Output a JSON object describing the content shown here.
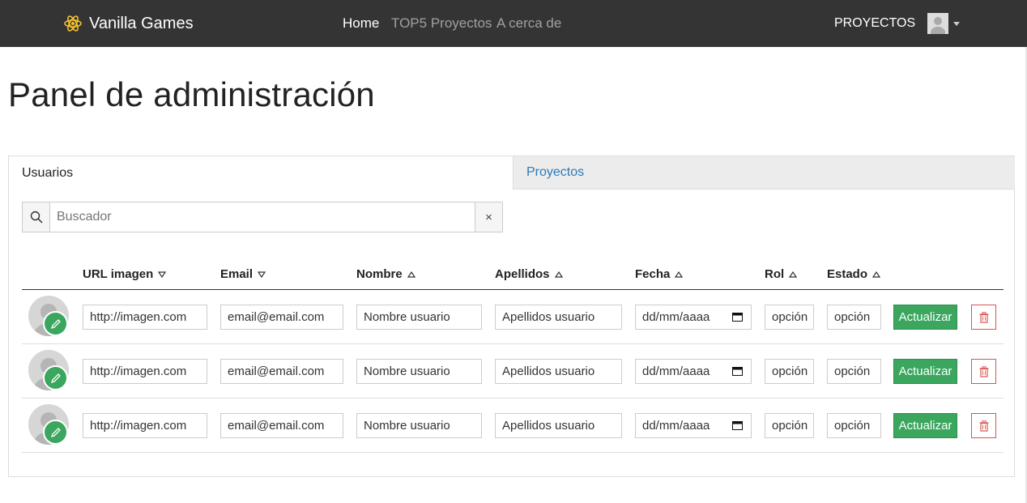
{
  "navbar": {
    "brand": "Vanilla Games",
    "links": [
      {
        "label": "Home",
        "active": true
      },
      {
        "label": "TOP5 Proyectos",
        "active": false
      },
      {
        "label": "A cerca de",
        "active": false
      }
    ],
    "user_menu_label": "PROYECTOS",
    "logo_icon": "atom-icon",
    "logo_color": "#f2c230"
  },
  "page_title": "Panel de administración",
  "tabs": [
    {
      "label": "Usuarios",
      "active": true
    },
    {
      "label": "Proyectos",
      "active": false
    }
  ],
  "search": {
    "placeholder": "Buscador",
    "clear_label": "×"
  },
  "table": {
    "columns": [
      {
        "label": "URL imagen",
        "sort": "desc"
      },
      {
        "label": "Email",
        "sort": "desc"
      },
      {
        "label": "Nombre",
        "sort": "asc"
      },
      {
        "label": "Apellidos",
        "sort": "asc"
      },
      {
        "label": "Fecha",
        "sort": "asc"
      },
      {
        "label": "Rol",
        "sort": "asc"
      },
      {
        "label": "Estado",
        "sort": "asc"
      }
    ],
    "rows": [
      {
        "url": "http://imagen.com",
        "email": "email@email.com",
        "nombre": "Nombre usuario",
        "apellidos": "Apellidos usuario",
        "fecha": "dd/mm/aaaa",
        "rol": "opción",
        "estado": "opción",
        "update_label": "Actualizar"
      },
      {
        "url": "http://imagen.com",
        "email": "email@email.com",
        "nombre": "Nombre usuario",
        "apellidos": "Apellidos usuario",
        "fecha": "dd/mm/aaaa",
        "rol": "opción",
        "estado": "opción",
        "update_label": "Actualizar"
      },
      {
        "url": "http://imagen.com",
        "email": "email@email.com",
        "nombre": "Nombre usuario",
        "apellidos": "Apellidos usuario",
        "fecha": "dd/mm/aaaa",
        "rol": "opción",
        "estado": "opción",
        "update_label": "Actualizar"
      }
    ]
  },
  "colors": {
    "navbar_bg": "#343434",
    "success": "#3aa65e",
    "danger": "#d9534f",
    "link": "#2a7ab8"
  }
}
